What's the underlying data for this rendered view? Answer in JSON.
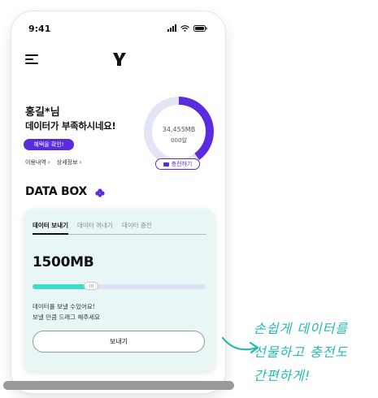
{
  "status_bar": {
    "time": "9:41"
  },
  "header": {
    "logo": "Y"
  },
  "profile": {
    "greeting": "홍길*님",
    "message": "데이터가 부족하시네요!",
    "benefit_button": "혜택을 확인!",
    "links": [
      "이용내역",
      "상세정보"
    ]
  },
  "usage": {
    "amount": "34,455MB",
    "price": "000알",
    "charge_button": "충전하기",
    "used_fraction": 0.4,
    "color_used": "#5b2be0",
    "color_remaining": "#e3e5f6"
  },
  "databox": {
    "title": "DATA BOX",
    "tabs": [
      {
        "label": "데이터 보내기",
        "active": true
      },
      {
        "label": "데이터 꺼내기",
        "active": false
      },
      {
        "label": "데이터 충전",
        "active": false
      }
    ],
    "amount": "1500MB",
    "slider_fraction": 0.34,
    "hint_line1": "데이터를 보낼 수있어요!",
    "hint_line2": "보낼 만큼 드래그 해주세요",
    "send_button": "보내기",
    "color_card": "#e8f7f5",
    "color_fill": "#3ddcc9"
  },
  "caption": {
    "line1": "손쉽게 데이터를",
    "line2": "선물하고 충전도",
    "line3": "간편하게!",
    "color": "#22b9b0"
  }
}
